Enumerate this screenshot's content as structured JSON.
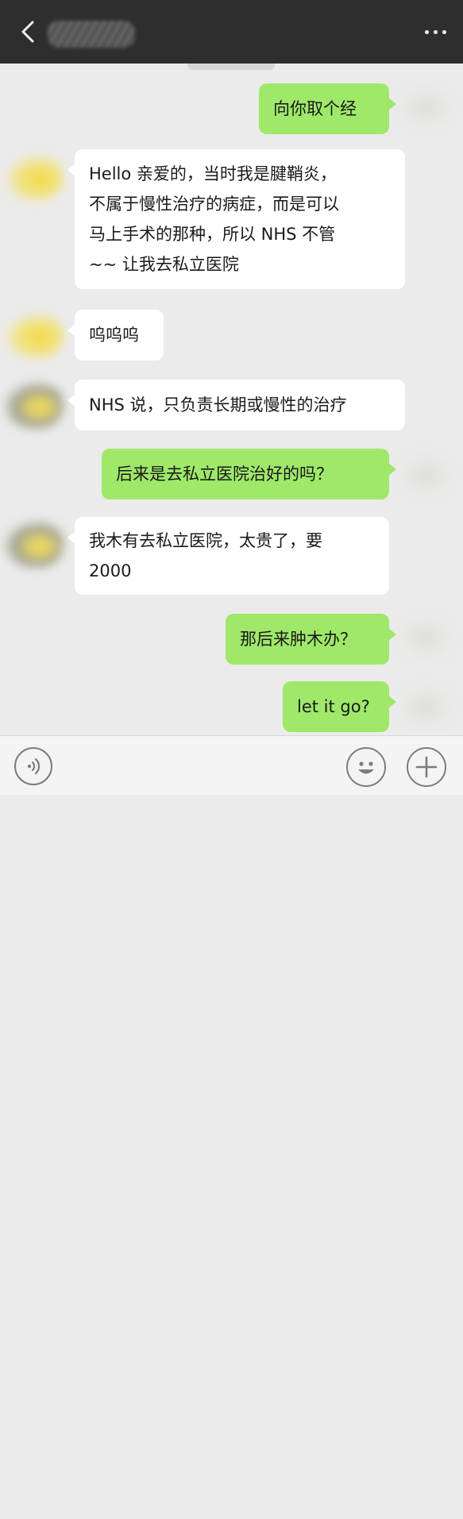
{
  "header": {
    "back_icon": "chevron-left-icon",
    "more_icon": "more-dots-icon",
    "title_obscured": true
  },
  "messages": [
    {
      "side": "out",
      "lines": [
        "向你取个经"
      ]
    },
    {
      "side": "in",
      "lines": [
        "Hello 亲爱的，当时我是腱鞘炎，",
        "不属于慢性治疗的病症，而是可以",
        "马上手术的那种，所以 NHS 不管",
        "~~ 让我去私立医院"
      ]
    },
    {
      "side": "in",
      "lines": [
        "呜呜呜"
      ]
    },
    {
      "side": "in",
      "lines": [
        "NHS 说，只负责长期或慢性的治疗"
      ]
    },
    {
      "side": "out",
      "lines": [
        "后来是去私立医院治好的吗？"
      ]
    },
    {
      "side": "in",
      "lines": [
        "我木有去私立医院，太贵了，要",
        "2000"
      ]
    },
    {
      "side": "out",
      "lines": [
        "那后来肿木办？"
      ]
    },
    {
      "side": "out",
      "lines": [
        "let it go?"
      ]
    }
  ],
  "input_bar": {
    "voice_icon": "voice-icon",
    "emoji_icon": "emoji-icon",
    "plus_icon": "plus-icon"
  },
  "colors": {
    "header_bg": "#2e2e2e",
    "chat_bg": "#ebebeb",
    "incoming_bubble": "#ffffff",
    "outgoing_bubble": "#9fe86a"
  }
}
